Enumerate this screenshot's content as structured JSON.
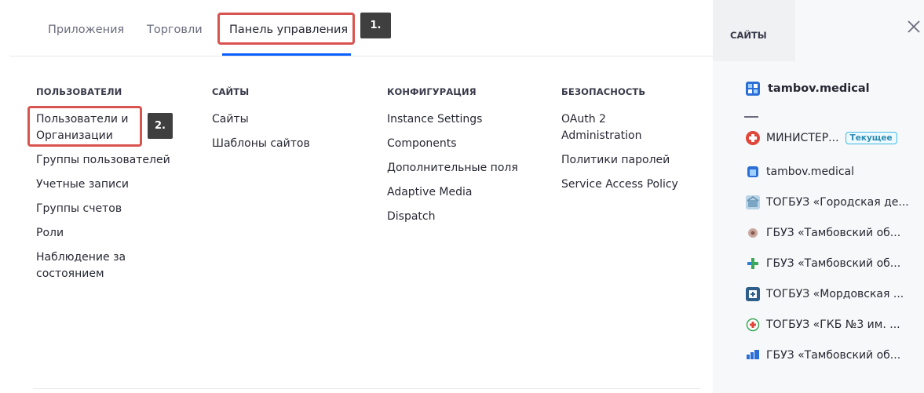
{
  "tabs": {
    "apps": "Приложения",
    "commerce": "Торговли",
    "control_panel": "Панель управления"
  },
  "callouts": {
    "one": "1.",
    "two": "2."
  },
  "columns": {
    "users": {
      "title": "ПОЛЬЗОВАТЕЛИ",
      "items": [
        "Пользователи и Организации",
        "Группы пользователей",
        "Учетные записи",
        "Группы счетов",
        "Роли",
        "Наблюдение за состоянием"
      ]
    },
    "sites": {
      "title": "САЙТЫ",
      "items": [
        "Сайты",
        "Шаблоны сайтов"
      ]
    },
    "configuration": {
      "title": "КОНФИГУРАЦИЯ",
      "items": [
        "Instance Settings",
        "Components",
        "Дополнительные поля",
        "Adaptive Media",
        "Dispatch"
      ]
    },
    "security": {
      "title": "БЕЗОПАСНОСТЬ",
      "items": [
        "OAuth 2 Administration",
        "Политики паролей",
        "Service Access Policy"
      ]
    }
  },
  "side_panel": {
    "tab_label": "САЙТЫ",
    "current_site": "tambov.medical",
    "current_badge": "Текущее",
    "sites": [
      "МИНИСТЕР...",
      "tambov.medical",
      "ТОГБУЗ «Городская де...",
      "ГБУЗ «Тамбовский об...",
      "ГБУЗ «Тамбовский об...",
      "ТОГБУЗ «Мордовская ...",
      "ТОГБУЗ «ГКБ №3 им. ...",
      "ГБУЗ «Тамбовский об..."
    ]
  },
  "colors": {
    "accent": "#0b5fff",
    "highlight_box": "#d9534f",
    "callout_bg": "#3f3f3f",
    "badge_border": "#3ebae0"
  }
}
